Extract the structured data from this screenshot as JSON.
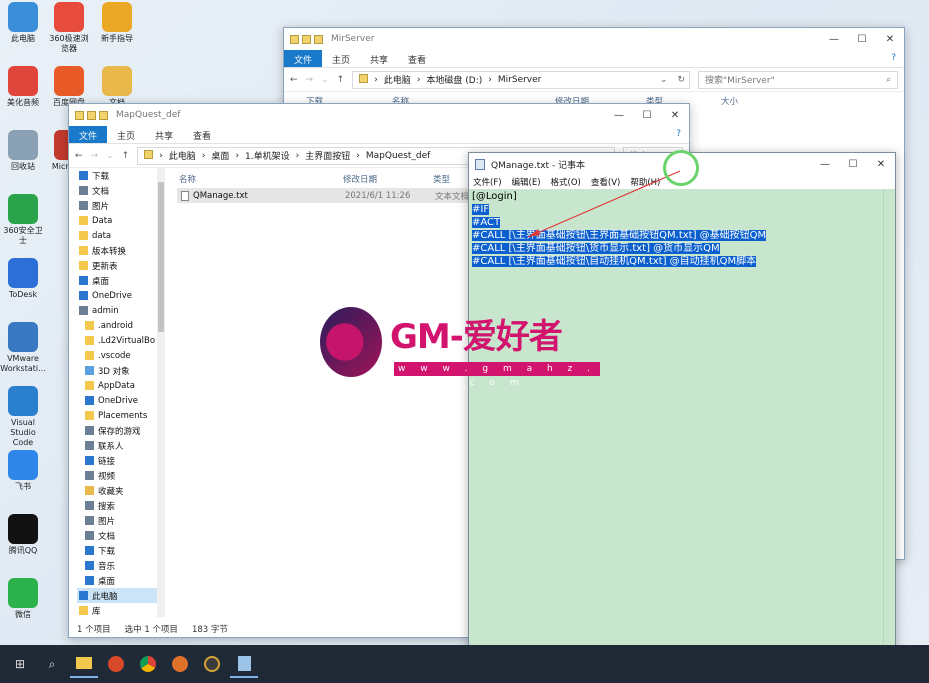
{
  "desktop": {
    "icons_left": [
      {
        "label": "此电脑",
        "color": "#3a8fd8"
      },
      {
        "label": "美化音频",
        "color": "#e0463c"
      },
      {
        "label": "回收站",
        "color": "#8aa0b5"
      },
      {
        "label": "360安全卫士",
        "color": "#2aa34a"
      },
      {
        "label": "ToDesk",
        "color": "#2c6fd6"
      },
      {
        "label": "VMware Workstati...",
        "color": "#3a78c4"
      },
      {
        "label": "Visual Studio Code",
        "color": "#2a7fcf"
      },
      {
        "label": "飞书",
        "color": "#2f86e8"
      },
      {
        "label": "腾讯QQ",
        "color": "#111111"
      },
      {
        "label": "微信",
        "color": "#2bb24c"
      }
    ],
    "icons_col2": [
      {
        "label": "360极速浏览器",
        "color": "#e64b3c"
      },
      {
        "label": "百度网盘",
        "color": "#e85a28"
      },
      {
        "label": "MicroS...",
        "color": "#c33a2e"
      }
    ],
    "icons_col3": [
      {
        "label": "新手指导",
        "color": "#eaa826"
      },
      {
        "label": "文档",
        "color": "#e8b84a"
      }
    ]
  },
  "mirserver_window": {
    "title": "MirServer",
    "ribbon": {
      "file": "文件",
      "tabs": [
        "主页",
        "共享",
        "查看"
      ]
    },
    "path": [
      "此电脑",
      "本地磁盘 (D:)",
      "MirServer"
    ],
    "search_placeholder": "搜索\"MirServer\"",
    "nav_first": "下载",
    "columns": [
      "名称",
      "修改日期",
      "类型",
      "大小"
    ]
  },
  "mapquest_window": {
    "title": "MapQuest_def",
    "ribbon": {
      "file": "文件",
      "tabs": [
        "主页",
        "共享",
        "查看"
      ]
    },
    "path": [
      "此电脑",
      "桌面",
      "1.单机架设",
      "主界面按钮",
      "MapQuest_def"
    ],
    "search_placeholder": "搜索\"MapQuest_def\"",
    "columns": [
      "名称",
      "修改日期",
      "类型"
    ],
    "files": [
      {
        "name": "QManage.txt",
        "date": "2021/6/1 11:26",
        "type": "文本文档"
      }
    ],
    "nav": [
      {
        "label": "下载",
        "icon": "download-icon",
        "color": "#2b77d0"
      },
      {
        "label": "文档",
        "icon": "document-icon",
        "color": "#6d7f94"
      },
      {
        "label": "图片",
        "icon": "picture-icon",
        "color": "#6d7f94"
      },
      {
        "label": "Data",
        "icon": "folder-icon",
        "color": "#f2c94c"
      },
      {
        "label": "data",
        "icon": "folder-icon",
        "color": "#f2c94c"
      },
      {
        "label": "版本转换",
        "icon": "folder-icon",
        "color": "#f2c94c"
      },
      {
        "label": "更新表",
        "icon": "folder-icon",
        "color": "#f2c94c"
      },
      {
        "label": "桌面",
        "icon": "desktop-icon",
        "color": "#2b77d0"
      },
      {
        "label": "OneDrive",
        "icon": "cloud-icon",
        "color": "#2b77d0"
      },
      {
        "label": "admin",
        "icon": "user-icon",
        "color": "#6d7f94"
      },
      {
        "label": ".android",
        "icon": "folder-icon",
        "color": "#f2c94c"
      },
      {
        "label": ".Ld2VirtualBo",
        "icon": "folder-icon",
        "color": "#f2c94c"
      },
      {
        "label": ".vscode",
        "icon": "folder-icon",
        "color": "#f2c94c"
      },
      {
        "label": "3D 对象",
        "icon": "3d-icon",
        "color": "#5aa0e0"
      },
      {
        "label": "AppData",
        "icon": "folder-icon",
        "color": "#f2c94c"
      },
      {
        "label": "OneDrive",
        "icon": "cloud-icon",
        "color": "#2b77d0"
      },
      {
        "label": "Placements",
        "icon": "folder-icon",
        "color": "#f2c94c"
      },
      {
        "label": "保存的游戏",
        "icon": "game-icon",
        "color": "#6d7f94"
      },
      {
        "label": "联系人",
        "icon": "contacts-icon",
        "color": "#6d7f94"
      },
      {
        "label": "链接",
        "icon": "link-icon",
        "color": "#2b77d0"
      },
      {
        "label": "视频",
        "icon": "video-icon",
        "color": "#6d7f94"
      },
      {
        "label": "收藏夹",
        "icon": "star-icon",
        "color": "#e8b84a"
      },
      {
        "label": "搜索",
        "icon": "search-icon",
        "color": "#6d7f94"
      },
      {
        "label": "图片",
        "icon": "picture-icon",
        "color": "#6d7f94"
      },
      {
        "label": "文档",
        "icon": "document-icon",
        "color": "#6d7f94"
      },
      {
        "label": "下载",
        "icon": "download-icon",
        "color": "#2b77d0"
      },
      {
        "label": "音乐",
        "icon": "music-icon",
        "color": "#2b77d0"
      },
      {
        "label": "桌面",
        "icon": "desktop-icon",
        "color": "#2b77d0"
      },
      {
        "label": "此电脑",
        "icon": "computer-icon",
        "color": "#2b77d0"
      },
      {
        "label": "库",
        "icon": "library-icon",
        "color": "#f2c94c"
      }
    ],
    "status": [
      "1 个项目",
      "选中 1 个项目",
      "183 字节"
    ]
  },
  "notepad": {
    "title": "QManage.txt - 记事本",
    "menu": [
      "文件(F)",
      "编辑(E)",
      "格式(O)",
      "查看(V)",
      "帮助(H)"
    ],
    "lines": [
      {
        "text": "[@Login]",
        "selected": false
      },
      {
        "text": "#IF",
        "selected": true
      },
      {
        "text": "#ACT",
        "selected": true
      },
      {
        "text": "#CALL [\\主界面基础按钮\\主界面基础按钮QM.txt] @基础按钮QM",
        "selected": true
      },
      {
        "text": "#CALL [\\主界面基础按钮\\货币显示.txt] @货币显示QM",
        "selected": true
      },
      {
        "text": "#CALL [\\主界面基础按钮\\自动挂机QM.txt] @自动挂机QM脚本",
        "selected": true
      }
    ]
  },
  "watermark": {
    "brand": "GM-爱好者",
    "url": "w w w . g m a h z . c o m"
  },
  "taskbar": {
    "items": [
      "windows-start-icon",
      "search-icon",
      "file-explorer-icon",
      "app-red-icon",
      "chrome-icon",
      "app-orange-icon",
      "app-clock-icon",
      "notepad-icon"
    ]
  }
}
